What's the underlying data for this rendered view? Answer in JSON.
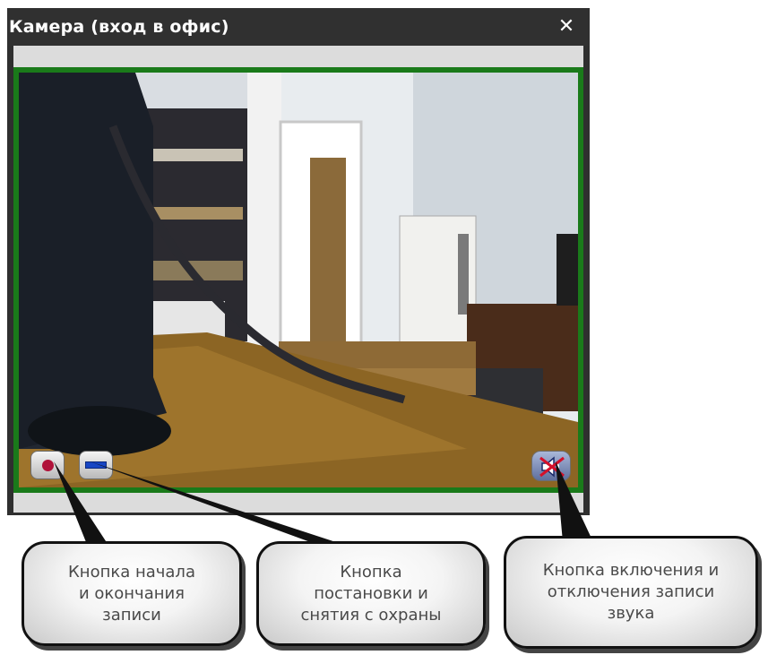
{
  "window": {
    "title": "Камера (вход в офис)",
    "close_glyph": "✕"
  },
  "controls": {
    "record_button": "record-icon",
    "arm_button": "arm-disarm-icon",
    "sound_button": "sound-muted-icon"
  },
  "callouts": [
    {
      "text": "Кнопка начала\nи окончания\nзаписи"
    },
    {
      "text": "Кнопка\nпостановки и\nснятия с охраны"
    },
    {
      "text": "Кнопка включения и\nотключения записи\nзвука"
    }
  ],
  "colors": {
    "frame_border": "#1a7a1a",
    "record": "#b0123a",
    "arm": "#1846c4"
  }
}
